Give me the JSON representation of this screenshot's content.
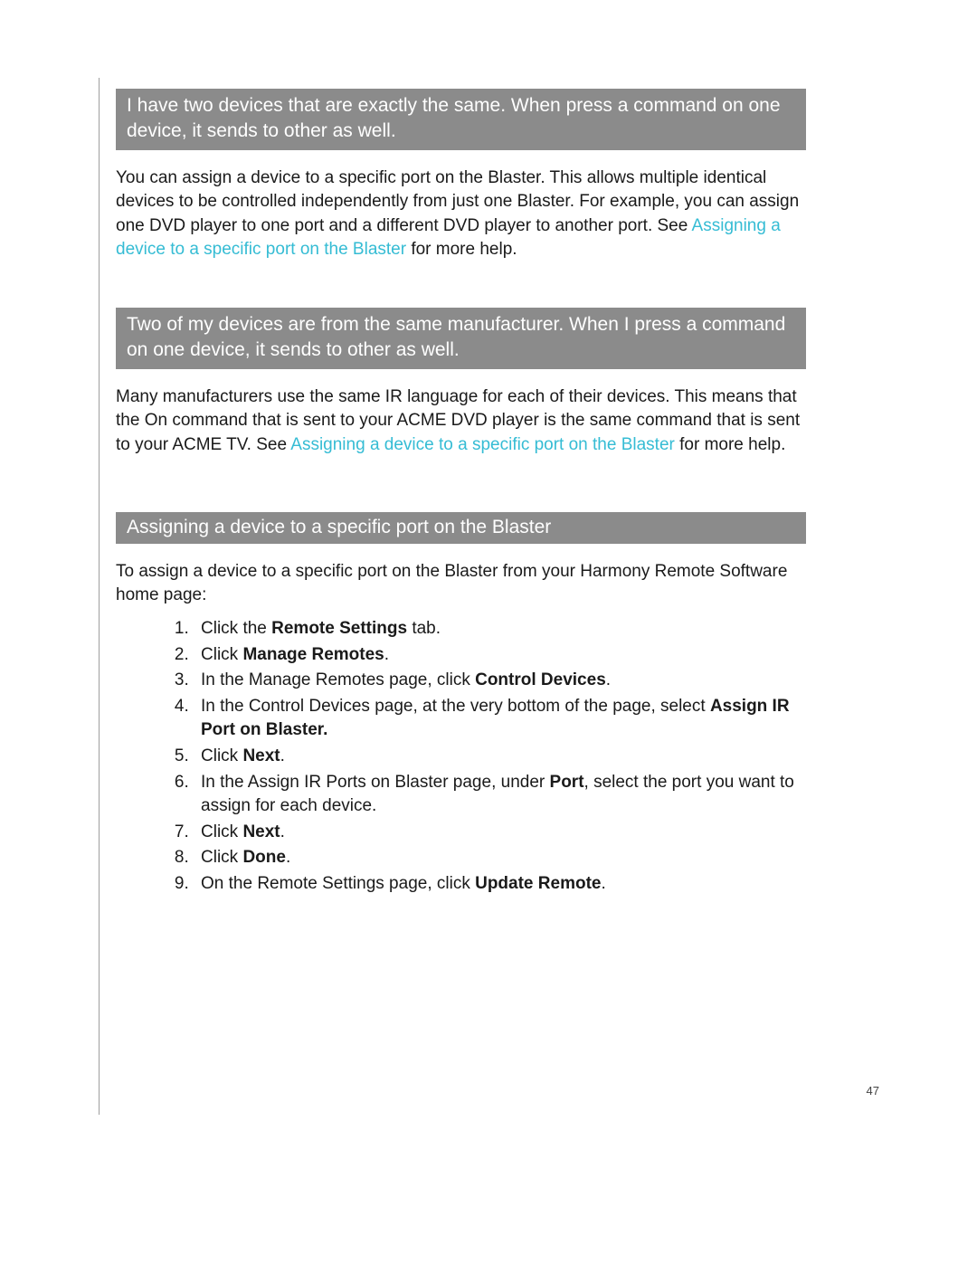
{
  "section1": {
    "heading": "I have two devices that are exactly the same. When press a command on one device, it sends to other as well.",
    "para_a": "You can assign a device to a specific port on the Blaster. This allows multiple identical devices to be controlled independently from just one Blaster. For example, you can assign one DVD player to one port and a different DVD player to another port. See ",
    "link": "Assigning a device to a specific port on the Blaster",
    "para_b": " for more help."
  },
  "section2": {
    "heading": "Two of my devices are from the same manufacturer. When I press a command on one device, it sends to other as well.",
    "para_a": "Many manufacturers use the same IR language for each of their devices. This means that the On command that is sent to your ACME DVD player is the same command that is sent to your ACME TV. See ",
    "link": "Assigning a device to a specific port on the Blaster",
    "para_b": " for more help."
  },
  "section3": {
    "heading": "Assigning a device to a specific port on the Blaster",
    "intro": "To assign a device to a specific port on the Blaster from your Harmony Remote Software home page:",
    "steps": {
      "s1a": "Click the ",
      "s1b": "Remote Settings",
      "s1c": " tab.",
      "s2a": "Click ",
      "s2b": "Manage Remotes",
      "s2c": ".",
      "s3a": "In the Manage Remotes page, click ",
      "s3b": "Control Devices",
      "s3c": ".",
      "s4a": "In the Control Devices page, at the very bottom of the page, select ",
      "s4b": "Assign IR Port on Blaster.",
      "s5a": "Click ",
      "s5b": "Next",
      "s5c": ".",
      "s6a": "In the Assign IR Ports on Blaster page, under ",
      "s6b": "Port",
      "s6c": ", select the port you want to assign for each device.",
      "s7a": "Click ",
      "s7b": "Next",
      "s7c": ".",
      "s8a": "Click ",
      "s8b": "Done",
      "s8c": ".",
      "s9a": "On the Remote Settings page, click ",
      "s9b": "Update Remote",
      "s9c": "."
    }
  },
  "page_number": "47"
}
